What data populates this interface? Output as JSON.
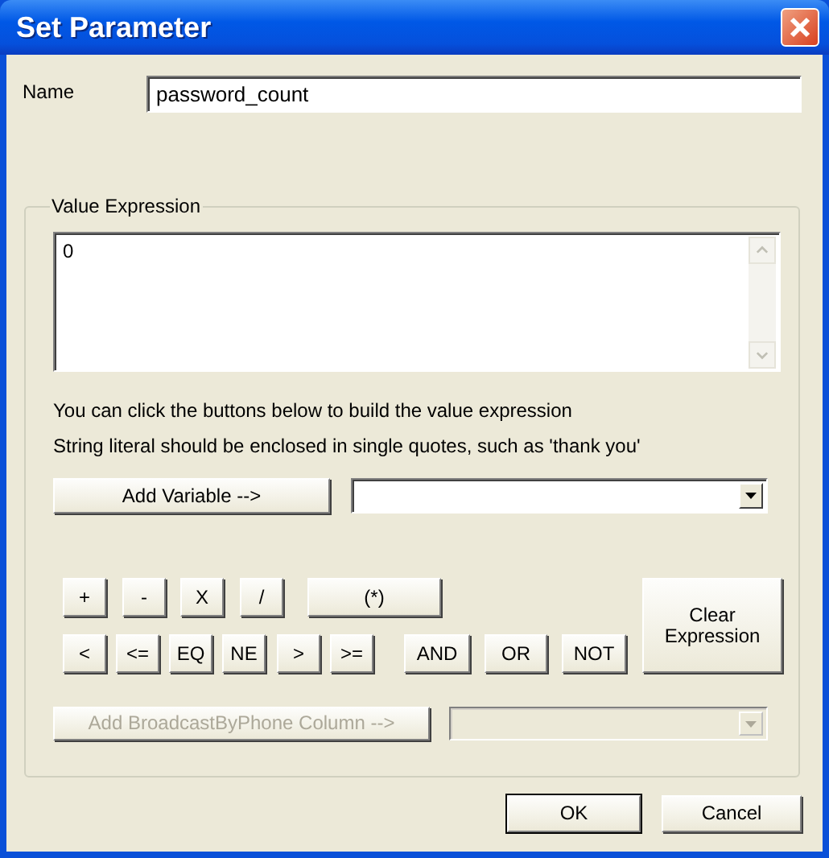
{
  "window": {
    "title": "Set Parameter"
  },
  "name_field": {
    "label": "Name",
    "value": "password_count"
  },
  "value_expression": {
    "legend": "Value Expression",
    "value": "0"
  },
  "hints": [
    "You can click the buttons below to build the value expression",
    "String literal should be enclosed in single quotes, such as 'thank you'"
  ],
  "add_variable": {
    "label": "Add Variable -->",
    "disabled": false
  },
  "variable_combo": {
    "disabled": false
  },
  "operator_rows": [
    [
      {
        "label": "+"
      },
      {
        "label": "-"
      },
      {
        "label": "X"
      },
      {
        "label": "/"
      },
      {
        "label": "(*)"
      }
    ],
    [
      {
        "label": "<"
      },
      {
        "label": "<="
      },
      {
        "label": "EQ"
      },
      {
        "label": "NE"
      },
      {
        "label": ">"
      },
      {
        "label": ">="
      },
      {
        "label": "AND"
      },
      {
        "label": "OR"
      },
      {
        "label": "NOT"
      }
    ]
  ],
  "clear_button": {
    "label": "Clear Expression"
  },
  "add_column": {
    "label": "Add BroadcastByPhone Column -->",
    "disabled": true
  },
  "column_combo": {
    "disabled": true
  },
  "buttons": [
    {
      "label": "OK",
      "default": true
    },
    {
      "label": "Cancel",
      "default": false
    }
  ]
}
